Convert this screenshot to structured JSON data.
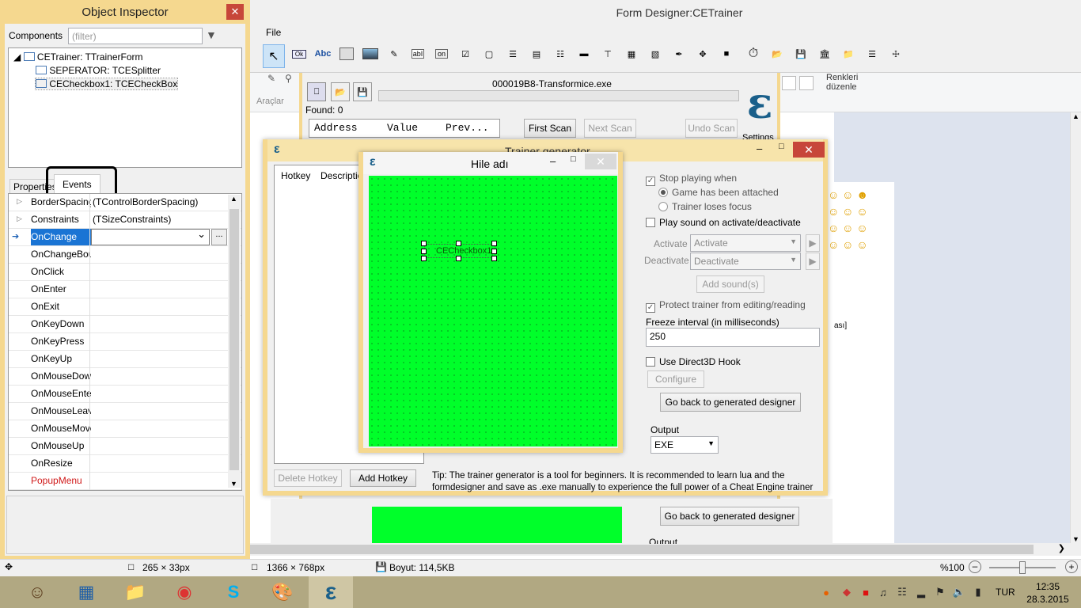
{
  "object_inspector": {
    "title": "Object Inspector",
    "components_label": "Components",
    "filter_placeholder": "(filter)",
    "tree": [
      "CETrainer: TTrainerForm",
      "SEPERATOR: TCESplitter",
      "CECheckbox1: TCECheckBox"
    ],
    "tab_properties": "Properties",
    "tab_events": "Events",
    "rows": [
      {
        "name": "BorderSpacing",
        "value": "(TControlBorderSpacing)"
      },
      {
        "name": "Constraints",
        "value": "(TSizeConstraints)"
      },
      {
        "name": "OnChange",
        "value": ""
      },
      {
        "name": "OnChangeBounds",
        "value": ""
      },
      {
        "name": "OnClick",
        "value": ""
      },
      {
        "name": "OnEnter",
        "value": ""
      },
      {
        "name": "OnExit",
        "value": ""
      },
      {
        "name": "OnKeyDown",
        "value": ""
      },
      {
        "name": "OnKeyPress",
        "value": ""
      },
      {
        "name": "OnKeyUp",
        "value": ""
      },
      {
        "name": "OnMouseDown",
        "value": ""
      },
      {
        "name": "OnMouseEnter",
        "value": ""
      },
      {
        "name": "OnMouseLeave",
        "value": ""
      },
      {
        "name": "OnMouseMove",
        "value": ""
      },
      {
        "name": "OnMouseUp",
        "value": ""
      },
      {
        "name": "OnResize",
        "value": ""
      },
      {
        "name": "PopupMenu",
        "value": ""
      }
    ],
    "ellipsis": "..."
  },
  "form_designer": {
    "title": "Form Designer:CETrainer",
    "menu_file": "File",
    "ok_label": "Ok",
    "abc_label": "Abc",
    "on_label": "on",
    "ab_label": "abI"
  },
  "cheat_engine": {
    "process": "000019B8-Transformice.exe",
    "found": "Found: 0",
    "col_address": "Address",
    "col_value": "Value",
    "col_prev": "Prev...",
    "first_scan": "First Scan",
    "next_scan": "Next Scan",
    "undo_scan": "Undo Scan",
    "settings": "Settings",
    "araclar": "Araçlar",
    "renkleri": "Renkleri",
    "duzenle": "düzenle"
  },
  "trainer_generator": {
    "title": "Trainer generator",
    "col_hotkey": "Hotkey",
    "col_description": "Description",
    "stop_playing_when": "Stop playing when",
    "game_attached": "Game has been attached",
    "trainer_loses_focus": "Trainer loses focus",
    "play_sound": "Play sound on activate/deactivate",
    "activate_label": "Activate",
    "activate_value": "Activate",
    "deactivate_label": "Deactivate",
    "deactivate_value": "Deactivate",
    "add_sounds": "Add sound(s)",
    "protect_trainer": "Protect trainer from editing/reading",
    "freeze_interval_label": "Freeze interval (in milliseconds)",
    "freeze_interval_value": "250",
    "use_direct3d": "Use Direct3D Hook",
    "configure": "Configure",
    "go_back": "Go back to generated designer",
    "output_label": "Output",
    "output_value": "EXE",
    "delete_hotkey": "Delete Hotkey",
    "add_hotkey": "Add Hotkey",
    "tip": "Tip: The trainer generator is a tool for beginners. It is recommended to learn lua and the formdesigner and save as .exe manually to experience the full power of a Cheat Engine trainer",
    "go_back_2": "Go back to generated designer",
    "output_partial": "Output",
    "asi_fragment": "ası]"
  },
  "hile": {
    "title": "Hile adı",
    "checkbox_caption": "CECheckbox1"
  },
  "status_bar": {
    "component_size": "265 × 33px",
    "image_size": "1366 × 768px",
    "file_size": "Boyut: 114,5KB",
    "zoom": "%100"
  },
  "tray": {
    "lang": "TUR",
    "time": "12:35",
    "date": "28.3.2015"
  },
  "colors": {
    "green_form": "#00ff2a",
    "ce_blue": "#1a5f8a",
    "win_border": "#f5d88f"
  }
}
